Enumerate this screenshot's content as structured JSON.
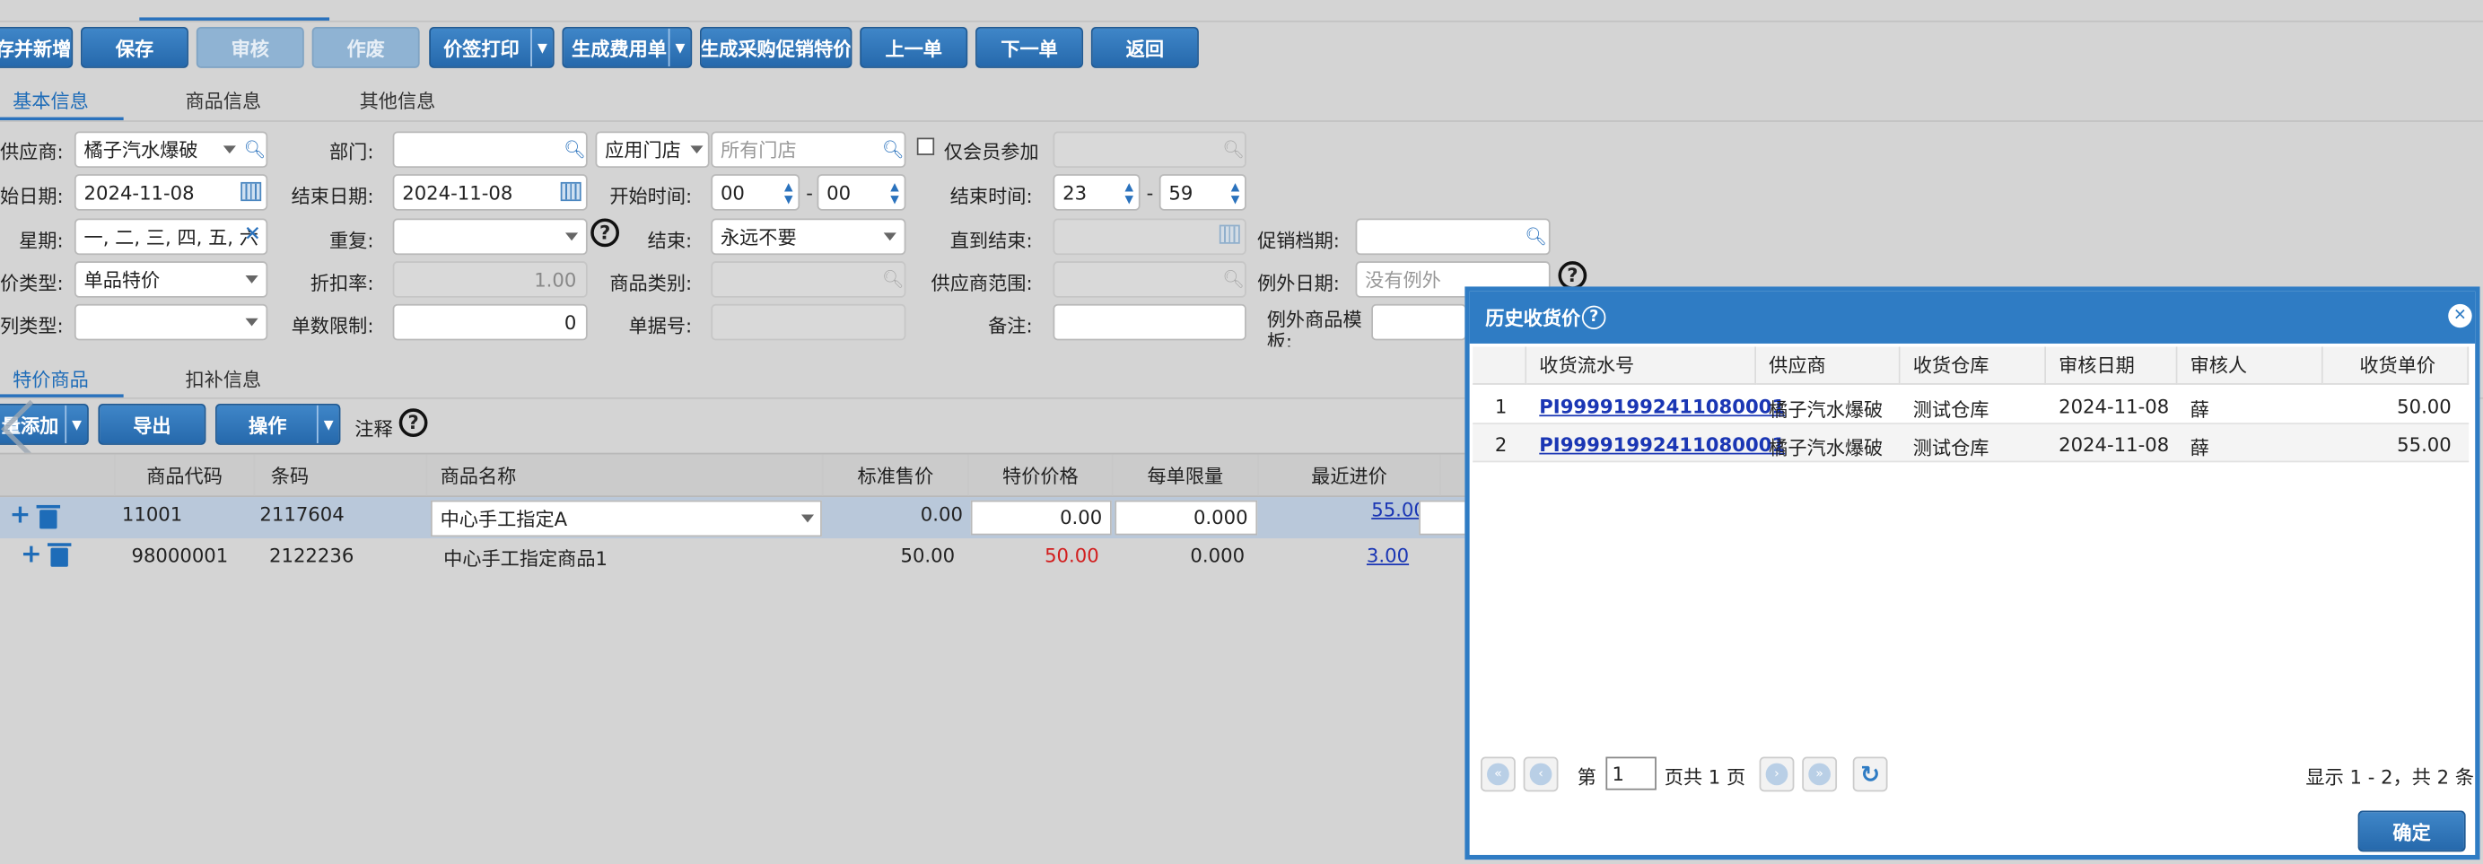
{
  "top_tabs": [
    "",
    "",
    ""
  ],
  "toolbar": {
    "save_new": "存并新增",
    "save": "保存",
    "audit": "审核",
    "void": "作废",
    "price_tag_print": "价签打印",
    "gen_expense": "生成费用单",
    "gen_purchase_promo": "生成采购促销特价",
    "prev": "上一单",
    "next": "下一单",
    "back": "返回"
  },
  "main_tabs": [
    "基本信息",
    "商品信息",
    "其他信息"
  ],
  "form": {
    "supplier_label": "供应商:",
    "supplier_value": "橘子汽水爆破",
    "dept_label": "部门:",
    "store_select": "应用门店",
    "store_placeholder": "所有门店",
    "member_only": "仅会员参加",
    "start_date_label": "始日期:",
    "start_date": "2024-11-08",
    "end_date_label": "结束日期:",
    "end_date": "2024-11-08",
    "start_time_label": "开始时间:",
    "start_hour": "00",
    "start_min": "00",
    "end_time_label": "结束时间:",
    "end_hour": "23",
    "end_min": "59",
    "dash": "-",
    "weekday_label": "星期:",
    "weekday_value": "一, 二, 三, 四, 五, 六",
    "repeat_label": "重复:",
    "end_label": "结束:",
    "end_value": "永远不要",
    "until_label": "直到结束:",
    "promo_period_label": "促销档期:",
    "price_type_label": "价类型:",
    "price_type_value": "单品特价",
    "discount_label": "折扣率:",
    "discount_value": "1.00",
    "category_label": "商品类别:",
    "supplier_range_label": "供应商范围:",
    "exception_date_label": "例外日期:",
    "exception_placeholder": "没有例外",
    "ex_type_label": "列类型:",
    "limit_label": "单数限制:",
    "limit_value": "0",
    "doc_no_label": "单据号:",
    "remark_label": "备注:",
    "exception_goods_label": "例外商品模板:"
  },
  "sub_tabs": [
    "特价商品",
    "扣补信息"
  ],
  "grid_toolbar": {
    "batch_add": "量添加",
    "export": "导出",
    "operate": "操作",
    "note": "注释"
  },
  "grid": {
    "columns": [
      "商品代码",
      "条码",
      "商品名称",
      "标准售价",
      "特价价格",
      "每单限量",
      "最近进价"
    ],
    "rows": [
      {
        "code": "11001",
        "barcode": "2117604",
        "name": "中心手工指定A",
        "std": "0.00",
        "special": "0.00",
        "limit": "0.000",
        "recent": "55.00"
      },
      {
        "code": "98000001",
        "barcode": "2122236",
        "name": "中心手工指定商品1",
        "std": "50.00",
        "special": "50.00",
        "limit": "0.000",
        "recent": "3.00"
      }
    ]
  },
  "modal": {
    "title": "历史收货价",
    "columns": [
      "收货流水号",
      "供应商",
      "收货仓库",
      "审核日期",
      "审核人",
      "收货单价"
    ],
    "rows": [
      {
        "idx": "1",
        "serial": "PI99991992411080001",
        "supplier": "橘子汽水爆破",
        "warehouse": "测试仓库",
        "date": "2024-11-08",
        "auditor": "薛",
        "price": "50.00"
      },
      {
        "idx": "2",
        "serial": "PI99991992411080001",
        "supplier": "橘子汽水爆破",
        "warehouse": "测试仓库",
        "date": "2024-11-08",
        "auditor": "薛",
        "price": "55.00"
      }
    ],
    "pager_prefix": "第",
    "page": "1",
    "pager_suffix": "页共 1 页",
    "summary": "显示 1 - 2，共 2 条",
    "confirm": "确定"
  },
  "colors": {
    "accent": "#2f7cc4",
    "link": "#1a36b4",
    "red": "#d21e1e"
  }
}
